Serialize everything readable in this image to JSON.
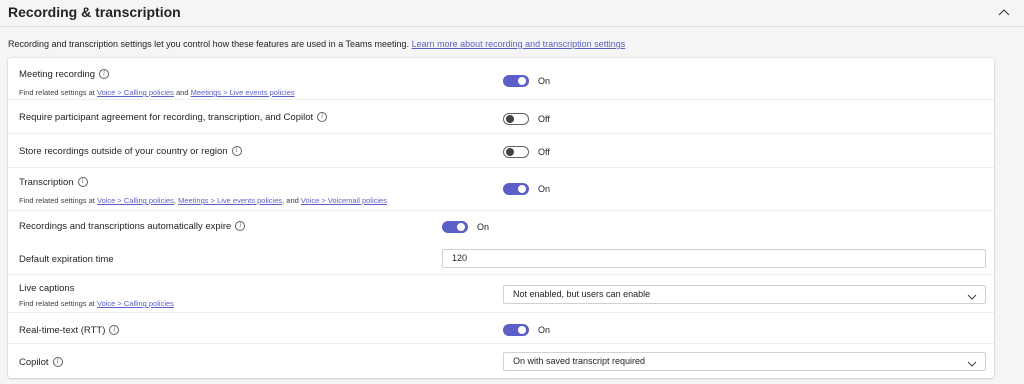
{
  "section": {
    "title": "Recording & transcription",
    "description": "Recording and transcription settings let you control how these features are used in a Teams meeting.",
    "learn_more": "Learn more about recording and transcription settings"
  },
  "settings": {
    "meeting_recording": {
      "label": "Meeting recording",
      "state": "On",
      "related_prefix": "Find related settings at",
      "link1": "Voice > Calling policies",
      "and": "and",
      "link2": "Meetings > Live events policies"
    },
    "participant_agreement": {
      "label": "Require participant agreement for recording, transcription, and Copilot",
      "state": "Off"
    },
    "store_outside": {
      "label": "Store recordings outside of your country or region",
      "state": "Off"
    },
    "transcription": {
      "label": "Transcription",
      "state": "On",
      "related_prefix": "Find related settings at",
      "link1": "Voice > Calling policies",
      "sep1": ",",
      "link2": "Meetings > Live events policies",
      "sep2": ", and",
      "link3": "Voice > Voicemail policies"
    },
    "auto_expire": {
      "label": "Recordings and transcriptions automatically expire",
      "state": "On"
    },
    "default_expiration": {
      "label": "Default expiration time",
      "value": "120"
    },
    "live_captions": {
      "label": "Live captions",
      "related_prefix": "Find related settings at",
      "link1": "Voice > Calling policies",
      "value": "Not enabled, but users can enable"
    },
    "rtt": {
      "label": "Real-time-text (RTT)",
      "state": "On"
    },
    "copilot": {
      "label": "Copilot",
      "value": "On with saved transcript required"
    }
  },
  "icons": {
    "info": "info-icon",
    "collapse": "chevron-up-icon",
    "dropdown": "chevron-down-icon"
  },
  "colors": {
    "accent": "#5b5fc7",
    "toggle_off_border": "#616161"
  }
}
